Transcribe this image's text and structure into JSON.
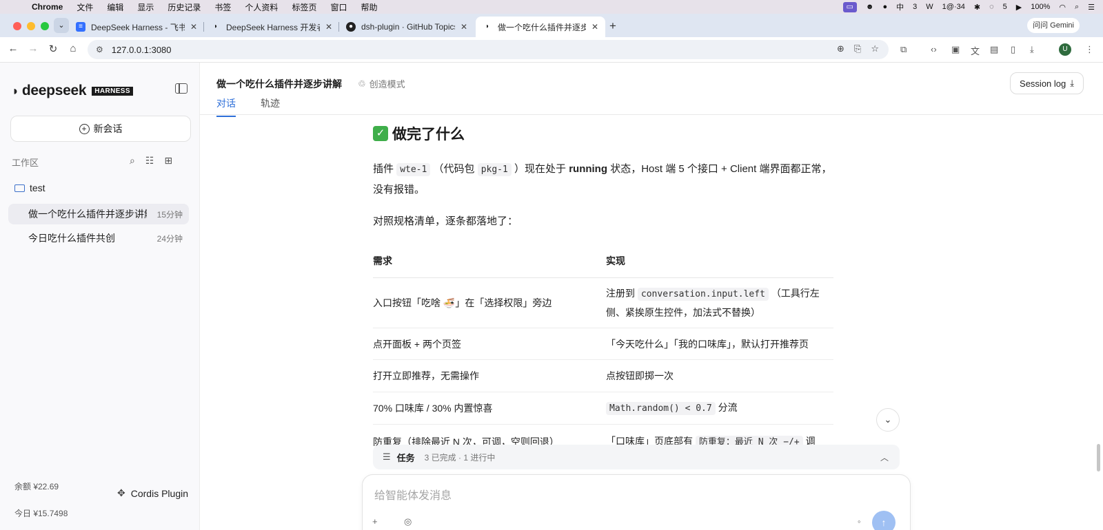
{
  "os_menubar": {
    "app": "Chrome",
    "menus": [
      "文件",
      "编辑",
      "显示",
      "历史记录",
      "书签",
      "个人资料",
      "标签页",
      "窗口",
      "帮助"
    ],
    "status_items": [
      "3",
      "1@·34",
      "5",
      "100%"
    ]
  },
  "browser": {
    "tabs": [
      {
        "title": "DeepSeek Harness - 飞书云文",
        "favicon": "doc-icon"
      },
      {
        "title": "DeepSeek Harness 开发者预览",
        "favicon": "deepseek-icon"
      },
      {
        "title": "dsh-plugin · GitHub Topics",
        "favicon": "github-icon"
      },
      {
        "title": "做一个吃什么插件并逐步讲解 -",
        "favicon": "deepseek-icon"
      }
    ],
    "ask_gemini": "问问 Gemini",
    "url": "127.0.0.1:3080"
  },
  "sidebar": {
    "brand": "deepseek",
    "brand_badge": "HARNESS",
    "new_chat_label": "新会话",
    "workspace_label": "工作区",
    "folder_name": "test",
    "sessions": [
      {
        "title": "做一个吃什么插件并逐步讲解",
        "time": "15分钟"
      },
      {
        "title": "今日吃什么插件共创",
        "time": "24分钟"
      }
    ],
    "balance_label": "余额 ¥22.69",
    "today_label": "今日 ¥15.7498",
    "plugin_label": "Cordis Plugin"
  },
  "conversation": {
    "title": "做一个吃什么插件并逐步讲解",
    "mode": "创造模式",
    "tabs": [
      "对话",
      "轨迹"
    ],
    "session_log_label": "Session log",
    "heading": "做完了什么",
    "p1_a": "插件",
    "p1_code1": "wte-1",
    "p1_b": "（代码包",
    "p1_code2": "pkg-1",
    "p1_c": "）现在处于",
    "p1_bold": "running",
    "p1_d": "状态，Host 端 5 个接口 + Client 端界面都正常，没有报错。",
    "p2": "对照规格清单，逐条都落地了：",
    "table": {
      "headers": [
        "需求",
        "实现"
      ],
      "rows": [
        {
          "req": "入口按钮「吃啥 🍜」在「选择权限」旁边",
          "impl_a": "注册到",
          "impl_code": "conversation.input.left",
          "impl_b": "（工具行左侧、紧挨原生控件，加法式不替换）"
        },
        {
          "req": "点开面板 + 两个页签",
          "impl_a": "「今天吃什么」「我的口味库」，默认打开推荐页",
          "impl_code": "",
          "impl_b": ""
        },
        {
          "req": "打开立即推荐，无需操作",
          "impl_a": "点按钮即掷一次",
          "impl_code": "",
          "impl_b": ""
        },
        {
          "req": "70% 口味库 / 30% 内置惊喜",
          "impl_a": "",
          "impl_code": "Math.random() < 0.7",
          "impl_b": "分流"
        },
        {
          "req": "防重复（排除最近 N 次，可调，空则回退）",
          "impl_a": "「口味库」页底部有",
          "impl_code": "防重复：最近 N 次 −/+",
          "impl_b": "调"
        }
      ]
    },
    "tasks_label": "任务",
    "tasks_status": "3 已完成 · 1 进行中",
    "composer_placeholder": "给智能体发消息"
  }
}
